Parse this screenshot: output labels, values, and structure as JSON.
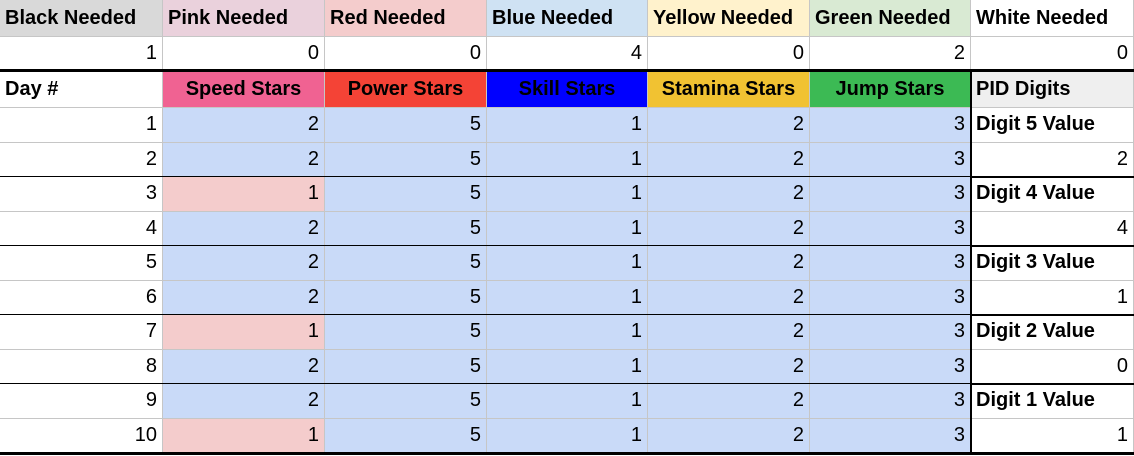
{
  "needed": [
    {
      "label": "Black Needed",
      "value": "1",
      "bg": "#d9d9d9"
    },
    {
      "label": "Pink Needed",
      "value": "0",
      "bg": "#ead1dc"
    },
    {
      "label": "Red Needed",
      "value": "0",
      "bg": "#f4cccc"
    },
    {
      "label": "Blue Needed",
      "value": "4",
      "bg": "#cfe2f3"
    },
    {
      "label": "Yellow Needed",
      "value": "0",
      "bg": "#fff2cc"
    },
    {
      "label": "Green Needed",
      "value": "2",
      "bg": "#d9ead3"
    },
    {
      "label": "White Needed",
      "value": "0",
      "bg": "#ffffff"
    }
  ],
  "table_header": {
    "day": "Day #",
    "columns": [
      {
        "label": "Speed Stars",
        "bg": "#f06292"
      },
      {
        "label": "Power Stars",
        "bg": "#f44336"
      },
      {
        "label": "Skill Stars",
        "bg": "#0000ff"
      },
      {
        "label": "Stamina Stars",
        "bg": "#f1c232"
      },
      {
        "label": "Jump Stars",
        "bg": "#3cba54"
      }
    ],
    "pid": "PID Digits"
  },
  "rows": [
    {
      "day": "1",
      "values": [
        "2",
        "5",
        "1",
        "2",
        "3"
      ],
      "speed_highlight": false
    },
    {
      "day": "2",
      "values": [
        "2",
        "5",
        "1",
        "2",
        "3"
      ],
      "speed_highlight": false
    },
    {
      "day": "3",
      "values": [
        "1",
        "5",
        "1",
        "2",
        "3"
      ],
      "speed_highlight": true
    },
    {
      "day": "4",
      "values": [
        "2",
        "5",
        "1",
        "2",
        "3"
      ],
      "speed_highlight": false
    },
    {
      "day": "5",
      "values": [
        "2",
        "5",
        "1",
        "2",
        "3"
      ],
      "speed_highlight": false
    },
    {
      "day": "6",
      "values": [
        "2",
        "5",
        "1",
        "2",
        "3"
      ],
      "speed_highlight": false
    },
    {
      "day": "7",
      "values": [
        "1",
        "5",
        "1",
        "2",
        "3"
      ],
      "speed_highlight": true
    },
    {
      "day": "8",
      "values": [
        "2",
        "5",
        "1",
        "2",
        "3"
      ],
      "speed_highlight": false
    },
    {
      "day": "9",
      "values": [
        "2",
        "5",
        "1",
        "2",
        "3"
      ],
      "speed_highlight": false
    },
    {
      "day": "10",
      "values": [
        "1",
        "5",
        "1",
        "2",
        "3"
      ],
      "speed_highlight": true
    }
  ],
  "pid_digits": [
    {
      "label": "Digit 5 Value",
      "value": "2"
    },
    {
      "label": "Digit 4 Value",
      "value": "4"
    },
    {
      "label": "Digit 3 Value",
      "value": "1"
    },
    {
      "label": "Digit 2 Value",
      "value": "0"
    },
    {
      "label": "Digit 1 Value",
      "value": "1"
    }
  ],
  "colors": {
    "data_bg": "#c9daf8",
    "highlight_bg": "#f4cccc",
    "grid": "#c6c6c6",
    "thick": "#000000",
    "skill_text": "#000000"
  }
}
